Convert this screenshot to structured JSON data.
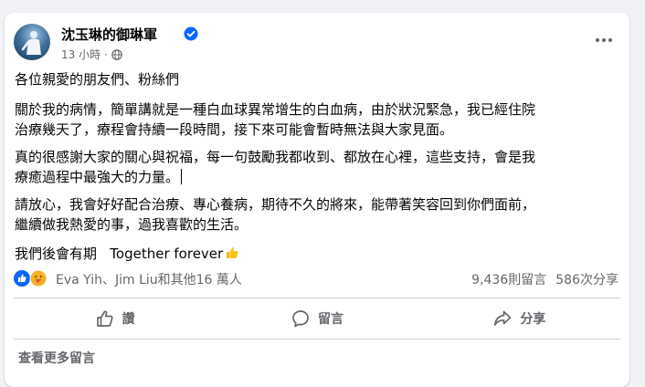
{
  "post": {
    "author": "沈玉琳的御琳軍",
    "time": "13 小時",
    "greeting": "各位親愛的朋友們、粉絲們",
    "paragraphs": [
      "關於我的病情，簡單講就是一種白血球異常增生的白血病，由於狀況緊急，我已經住院",
      "治療幾天了，療程會持續一段時間，接下來可能會暫時無法與大家見面。",
      "真的很感謝大家的關心與祝福，每一句鼓勵我都收到、都放在心裡，這些支持，會是我",
      "療癒過程中最強大的力量。",
      "請放心，我會好好配合治療、專心養病，期待不久的將來，能帶著笑容回到你們面前，",
      "繼續做我熱愛的事，過我喜歡的生活。"
    ],
    "closing": "我們後會有期   Together forever"
  },
  "stats": {
    "reactors": "Eva Yih、Jim Liu和其他16 萬人",
    "comments": "9,436則留言",
    "shares": "586次分享"
  },
  "actions": {
    "like": "讚",
    "comment": "留言",
    "share": "分享"
  },
  "more_comments": "查看更多留言",
  "colors": {
    "verified": "#0866ff",
    "like_reaction": "#0866ff",
    "care_reaction": "#f7b125",
    "secondary_text": "#65676b"
  },
  "icons": [
    "globe-icon",
    "verified-badge-icon",
    "more-options-icon",
    "like-reaction-icon",
    "care-reaction-icon",
    "thumbs-up-icon",
    "comment-icon",
    "share-icon",
    "thumbs-up-emoji"
  ]
}
